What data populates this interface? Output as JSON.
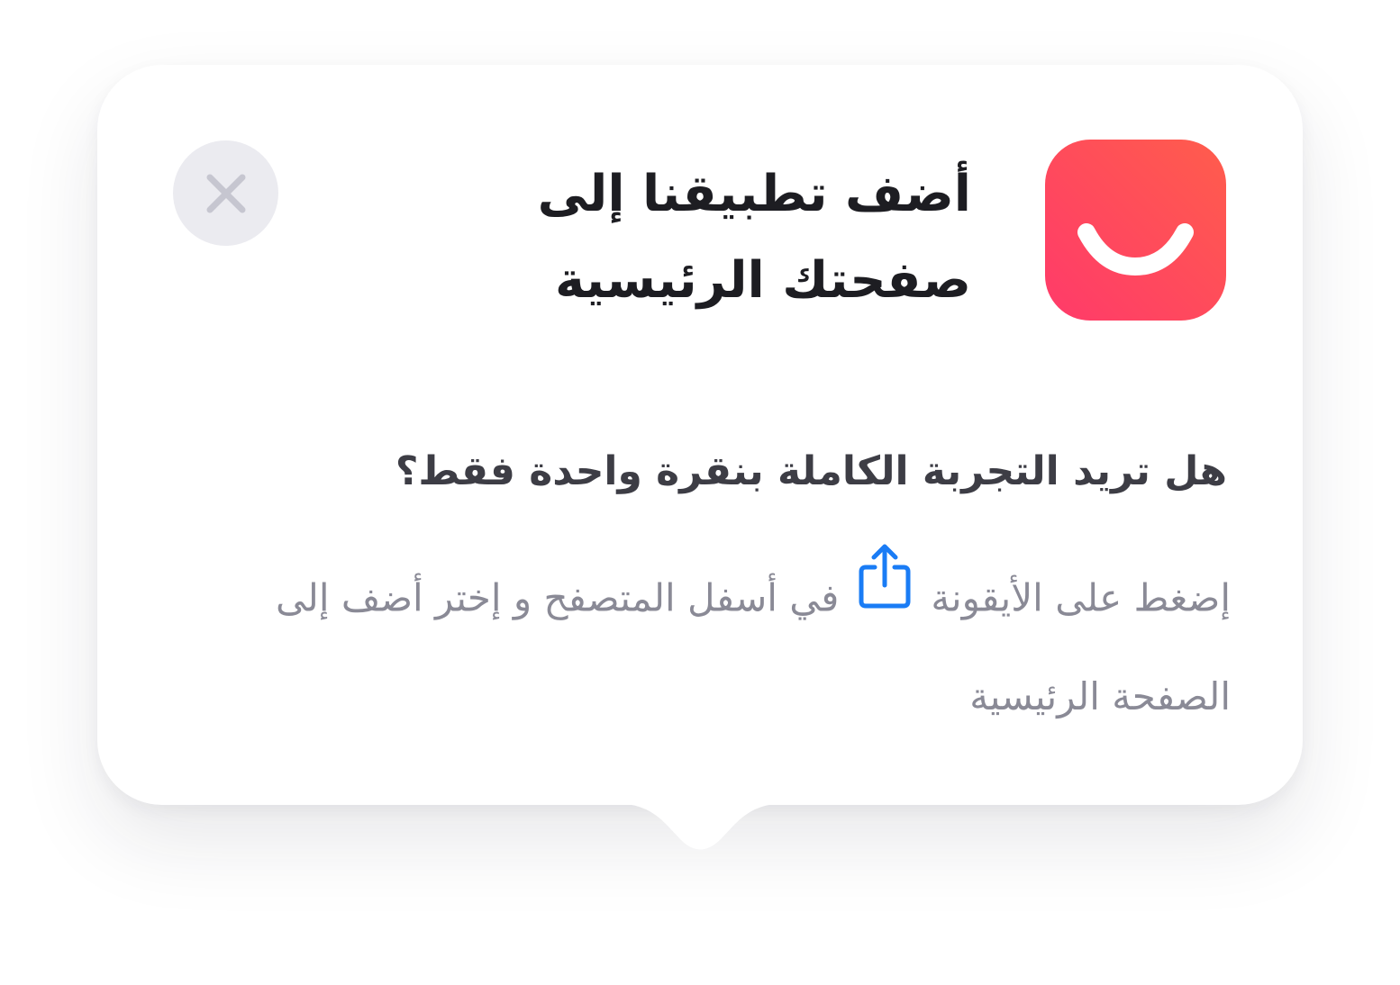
{
  "popup": {
    "title": "أضف تطبيقنا إلى صفحتك الرئيسية",
    "question": "هل تريد التجربة الكاملة بنقرة واحدة فقط؟",
    "instruction_before_icon": "إضغط على الأيقونة",
    "instruction_after_icon": "في أسفل المتصفح و إختر أضف إلى الصفحة الرئيسية",
    "app_icon": "smile-app-icon",
    "share_icon": "share-icon",
    "close_icon": "close-icon"
  },
  "colors": {
    "app_gradient_start": "#ff3a6a",
    "app_gradient_end": "#ff5d4c",
    "share_blue": "#1a7cf5",
    "close_bg": "#ebebf0",
    "close_x": "#c6c6d0",
    "title_text": "#1d1d22",
    "question_text": "#3d3d45",
    "body_text": "#8a8a96"
  }
}
